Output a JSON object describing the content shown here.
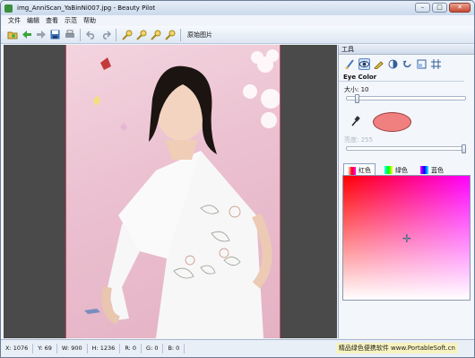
{
  "window": {
    "title": "img_AnniScan_YaBinNi007.jpg - Beauty Pilot"
  },
  "menu": [
    "文件",
    "编辑",
    "查看",
    "示范",
    "帮助"
  ],
  "toolbar": {
    "original_label": "原始图片"
  },
  "panel": {
    "title": "工具",
    "section": "Eye Color",
    "size_label": "大小: 10",
    "size_value": 10,
    "brightness_label": "亮度: 255",
    "current_color": "#f08080",
    "tabs": [
      "红色",
      "绿色",
      "蓝色"
    ]
  },
  "status": {
    "x": "X: 1076",
    "y": "Y: 69",
    "w": "W: 900",
    "h": "H: 1236",
    "r": "R: 0",
    "g": "G: 0",
    "b": "B: 0",
    "watermark": "精品绿色便携软件 www.PortableSoft.cn"
  }
}
